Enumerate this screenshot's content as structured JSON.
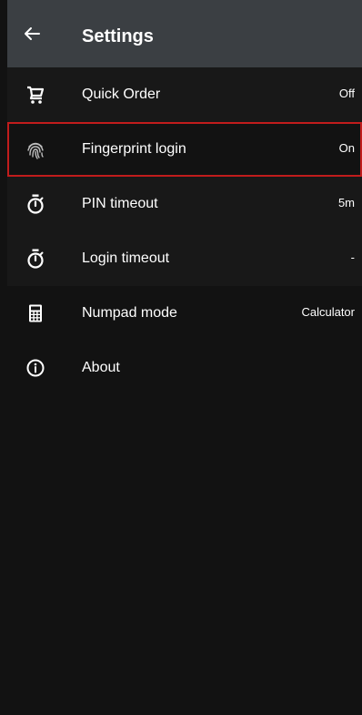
{
  "header": {
    "title": "Settings",
    "back_icon": "back-arrow-icon"
  },
  "settings": {
    "items": [
      {
        "label": "Quick Order",
        "value": "Off",
        "icon": "cart-icon"
      },
      {
        "label": "Fingerprint login",
        "value": "On",
        "icon": "fingerprint-icon"
      },
      {
        "label": "PIN timeout",
        "value": "5m",
        "icon": "timer-icon"
      },
      {
        "label": "Login timeout",
        "value": "-",
        "icon": "timer-icon"
      },
      {
        "label": "Numpad mode",
        "value": "Calculator",
        "icon": "calculator-icon"
      },
      {
        "label": "About",
        "value": "",
        "icon": "info-icon"
      }
    ]
  },
  "colors": {
    "app_bar": "#3b3f43",
    "background": "#121212",
    "text": "#ffffff",
    "highlight_border": "#c11c1c"
  }
}
